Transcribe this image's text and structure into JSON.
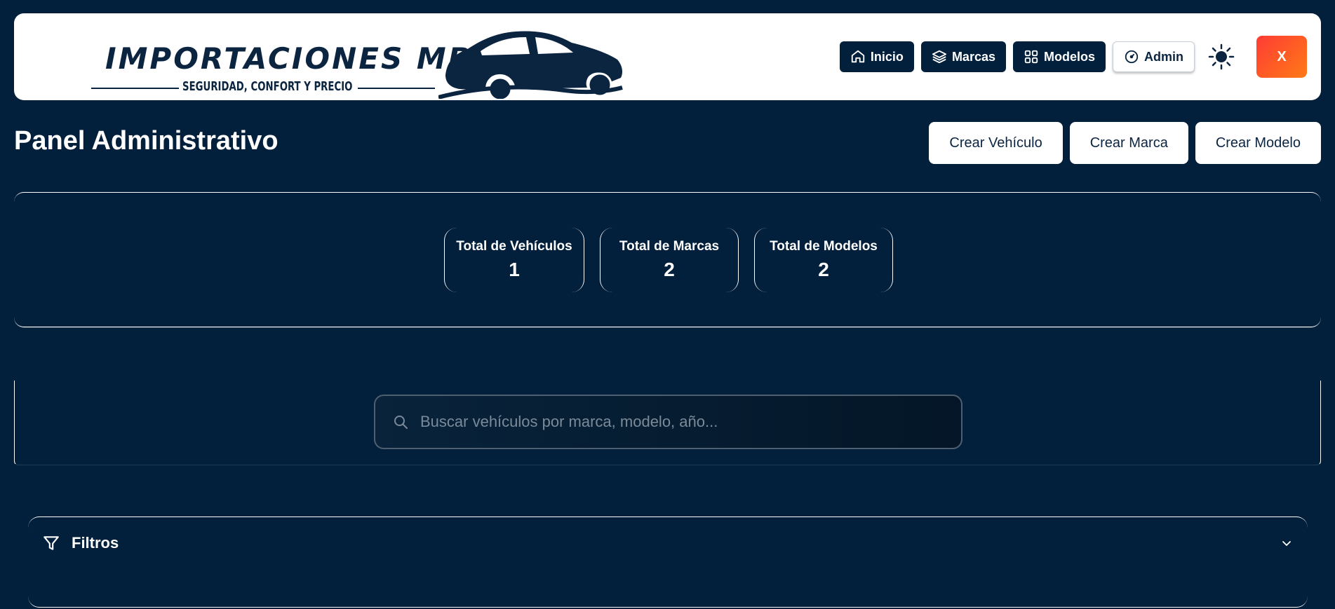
{
  "brand": {
    "name": "IMPORTACIONES MBV",
    "tagline": "SEGURIDAD, CONFORT Y PRECIO"
  },
  "nav": {
    "items": [
      {
        "label": "Inicio",
        "icon": "home-icon"
      },
      {
        "label": "Marcas",
        "icon": "layers-icon"
      },
      {
        "label": "Modelos",
        "icon": "grid-icon"
      },
      {
        "label": "Admin",
        "icon": "dashboard-icon",
        "active": true
      }
    ],
    "theme_toggle_icon": "sun-icon",
    "close_label": "X"
  },
  "page": {
    "title": "Panel Administrativo",
    "actions": [
      "Crear Vehículo",
      "Crear Marca",
      "Crear Modelo"
    ]
  },
  "stats": [
    {
      "label": "Total de Vehículos",
      "value": "1"
    },
    {
      "label": "Total de Marcas",
      "value": "2"
    },
    {
      "label": "Total de Modelos",
      "value": "2"
    }
  ],
  "search": {
    "placeholder": "Buscar vehículos por marca, modelo, año...",
    "value": ""
  },
  "filters": {
    "title": "Filtros",
    "expanded": false
  },
  "colors": {
    "background": "#02203c",
    "header_bg": "#ffffff",
    "nav_button": "#02203c",
    "close_gradient_start": "#ff3c35",
    "close_gradient_end": "#ff7a16"
  }
}
